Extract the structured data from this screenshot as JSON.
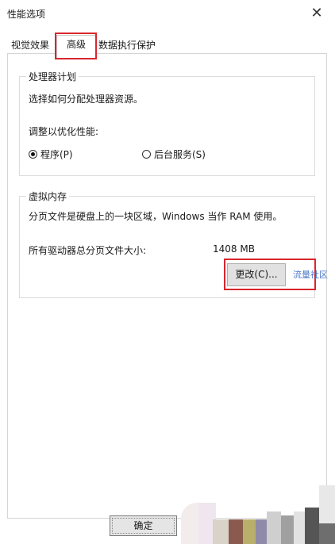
{
  "window": {
    "title": "性能选项",
    "close_glyph": "✕"
  },
  "tabs": [
    {
      "label": "视觉效果"
    },
    {
      "label": "高级",
      "selected": true
    },
    {
      "label": "数据执行保护"
    }
  ],
  "processor": {
    "group_title": "处理器计划",
    "description": "选择如何分配处理器资源。",
    "optimize_label": "调整以优化性能:",
    "option_programs": "程序(P)",
    "option_services": "后台服务(S)",
    "selected": "programs"
  },
  "virtual_memory": {
    "group_title": "虚拟内存",
    "description": "分页文件是硬盘上的一块区域，Windows 当作 RAM 使用。",
    "total_label": "所有驱动器总分页文件大小:",
    "total_value": "1408 MB",
    "change_button": "更改(C)..."
  },
  "watermark": "流量社区",
  "footer": {
    "ok_button": "确定"
  },
  "colors": {
    "highlight": "#d9262c",
    "watermark": "#4a78c8"
  }
}
